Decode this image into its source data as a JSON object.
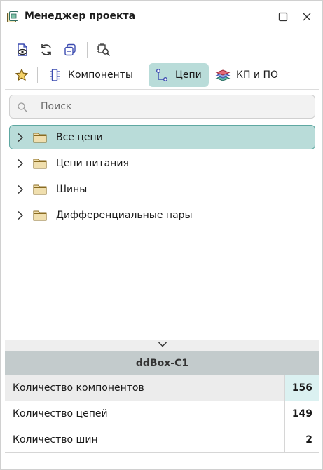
{
  "window": {
    "title": "Менеджер проекта"
  },
  "toolbar": {
    "icons": [
      "document-view-icon",
      "refresh-icon",
      "copy-icon",
      "inspect-icon"
    ]
  },
  "tabs": [
    {
      "label": "Компоненты",
      "icon": "component-icon",
      "active": false
    },
    {
      "label": "Цепи",
      "icon": "net-icon",
      "active": true
    },
    {
      "label": "КП и ПО",
      "icon": "layers-icon",
      "active": false
    }
  ],
  "search": {
    "placeholder": "Поиск",
    "value": ""
  },
  "tree": {
    "items": [
      {
        "label": "Все цепи",
        "selected": true
      },
      {
        "label": "Цепи питания",
        "selected": false
      },
      {
        "label": "Шины",
        "selected": false
      },
      {
        "label": "Дифференциальные пары",
        "selected": false
      }
    ]
  },
  "stats": {
    "header": "ddBox-C1",
    "rows": [
      {
        "label": "Количество компонентов",
        "value": "156"
      },
      {
        "label": "Количество цепей",
        "value": "149"
      },
      {
        "label": "Количество шин",
        "value": "2"
      }
    ]
  },
  "colors": {
    "accent": "#b9dcd9",
    "accent_border": "#5fa8a2",
    "folder": "#e9d8a6",
    "header_bg": "#c3cbcc"
  }
}
